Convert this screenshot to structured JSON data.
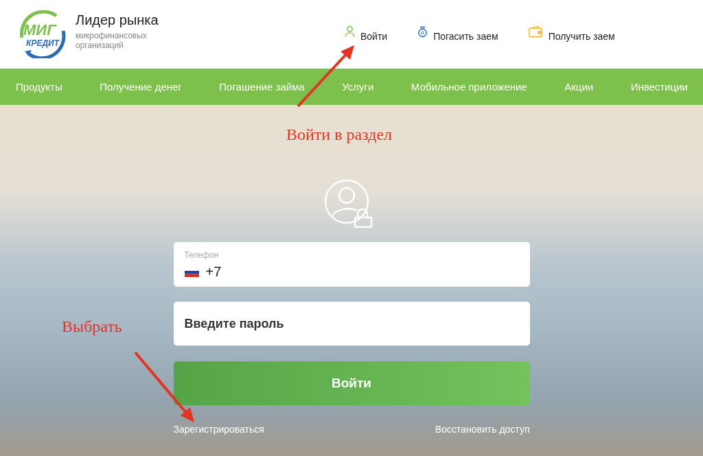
{
  "header": {
    "logo": {
      "line_1": "МИГ",
      "line_2": "КРЕДИТ"
    },
    "title": "Лидер рынка",
    "subtitle": "микрофинансовых организаций",
    "links": [
      {
        "label": "Войти",
        "kind": "user"
      },
      {
        "label": "Погасить заем",
        "kind": "coin"
      },
      {
        "label": "Получить заем",
        "kind": "wallet"
      }
    ]
  },
  "nav": [
    "Продукты",
    "Получение денег",
    "Погашение займа",
    "Услуги",
    "Мобильное приложение",
    "Акции",
    "Инвестиции"
  ],
  "login": {
    "phone": {
      "label": "Телефон",
      "value": "+7"
    },
    "password": {
      "placeholder": "Введите пароль"
    },
    "submit": "Войти",
    "register": "Зарегистрироваться",
    "restore": "Восстановить доступ"
  },
  "annotations": [
    {
      "text": "Войти в раздел",
      "kind": "title"
    },
    {
      "text": "Выбрать",
      "kind": "side"
    }
  ]
}
